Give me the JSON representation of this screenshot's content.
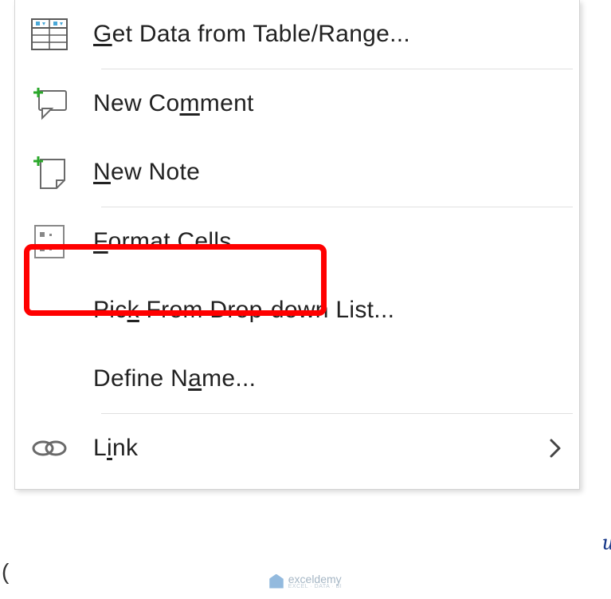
{
  "menu": {
    "items": [
      {
        "label_pre": "",
        "label_u": "G",
        "label_post": "et Data from Table/Range...",
        "icon": "table-icon"
      },
      {
        "label_pre": "New Co",
        "label_u": "m",
        "label_post": "ment",
        "icon": "new-comment-icon"
      },
      {
        "label_pre": "",
        "label_u": "N",
        "label_post": "ew Note",
        "icon": "new-note-icon"
      },
      {
        "label_pre": "",
        "label_u": "F",
        "label_post": "ormat Cells...",
        "icon": "format-cells-icon"
      },
      {
        "label_pre": "Pic",
        "label_u": "k",
        "label_post": " From Drop-down List...",
        "icon": ""
      },
      {
        "label_pre": "Define N",
        "label_u": "a",
        "label_post": "me...",
        "icon": ""
      },
      {
        "label_pre": "L",
        "label_u": "i",
        "label_post": "nk",
        "icon": "link-icon",
        "submenu": true
      }
    ]
  },
  "highlight": {
    "item_index": 3
  },
  "watermark": {
    "brand": "exceldemy",
    "tagline": "EXCEL · DATA · BI"
  }
}
